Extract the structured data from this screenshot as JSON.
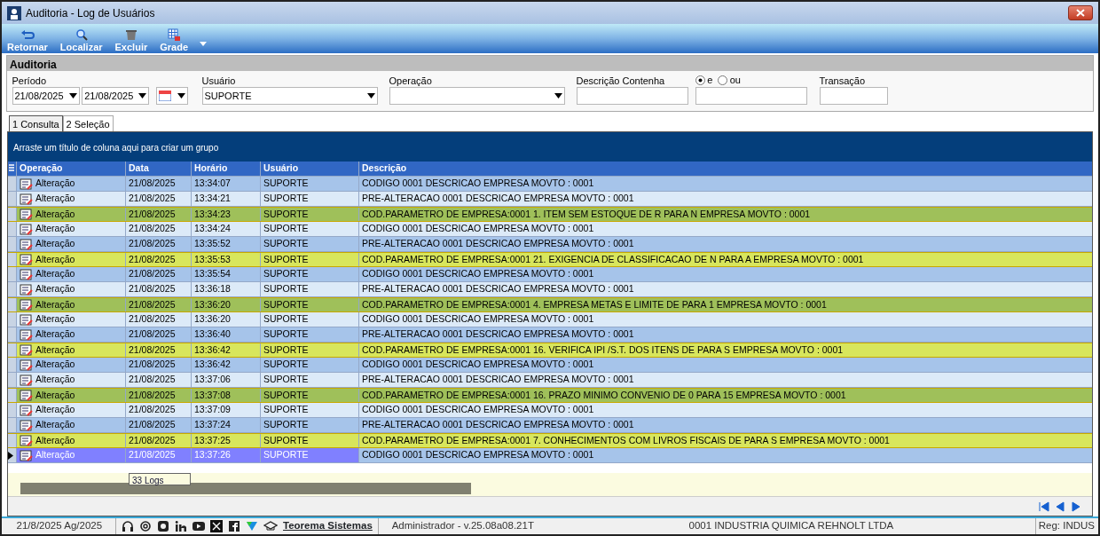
{
  "window": {
    "title": "Auditoria - Log de Usuários"
  },
  "toolbar": [
    {
      "label": "Retornar",
      "kind": "back"
    },
    {
      "label": "Localizar",
      "kind": "search"
    },
    {
      "label": "Excluir",
      "kind": "delete"
    },
    {
      "label": "Grade",
      "kind": "grid"
    }
  ],
  "filter_panel": {
    "title": "Auditoria",
    "period_label": "Período",
    "date_from": "21/08/2025",
    "date_to": "21/08/2025",
    "user_label": "Usuário",
    "user": "SUPORTE",
    "operation_label": "Operação",
    "description_label": "Descrição Contenha",
    "logic_options": [
      {
        "label": "e",
        "selected": true
      },
      {
        "label": "ou",
        "selected": false
      }
    ],
    "transaction_label": "Transação"
  },
  "tabs": [
    {
      "label": "1 Consulta",
      "selected": true
    },
    {
      "label": "2 Seleção",
      "selected": false
    }
  ],
  "group_hint": "Arraste um título de coluna aqui para criar um grupo",
  "table": {
    "columns": [
      "Operação",
      "Data",
      "Horário",
      "Usuário",
      "Descrição"
    ],
    "rows": [
      {
        "cells": [
          "Alteração",
          "21/08/2025",
          "13:34:07",
          "SUPORTE",
          "CODIGO 0001 DESCRICAO EMPRESA MOVTO : 0001"
        ],
        "color": "#a6c4ea",
        "selected": false
      },
      {
        "cells": [
          "Alteração",
          "21/08/2025",
          "13:34:21",
          "SUPORTE",
          "PRE-ALTERACAO 0001 DESCRICAO EMPRESA MOVTO : 0001"
        ],
        "color": "#dceaf8",
        "selected": false
      },
      {
        "cells": [
          "Alteração",
          "21/08/2025",
          "13:34:23",
          "SUPORTE",
          "COD.PARAMETRO DE EMPRESA:0001 1. ITEM SEM ESTOQUE DE R PARA N EMPRESA MOVTO : 0001"
        ],
        "color": "#9fc05a",
        "selected": false
      },
      {
        "cells": [
          "Alteração",
          "21/08/2025",
          "13:34:24",
          "SUPORTE",
          "CODIGO 0001 DESCRICAO EMPRESA MOVTO : 0001"
        ],
        "color": "#dceaf8",
        "selected": false
      },
      {
        "cells": [
          "Alteração",
          "21/08/2025",
          "13:35:52",
          "SUPORTE",
          "PRE-ALTERACAO 0001 DESCRICAO EMPRESA MOVTO : 0001"
        ],
        "color": "#a6c4ea",
        "selected": false
      },
      {
        "cells": [
          "Alteração",
          "21/08/2025",
          "13:35:53",
          "SUPORTE",
          "COD.PARAMETRO DE EMPRESA:0001 21. EXIGENCIA DE CLASSIFICACAO DE N PARA A EMPRESA MOVTO : 0001"
        ],
        "color": "#d8e65c",
        "selected": false
      },
      {
        "cells": [
          "Alteração",
          "21/08/2025",
          "13:35:54",
          "SUPORTE",
          "CODIGO 0001 DESCRICAO EMPRESA MOVTO : 0001"
        ],
        "color": "#a6c4ea",
        "selected": false
      },
      {
        "cells": [
          "Alteração",
          "21/08/2025",
          "13:36:18",
          "SUPORTE",
          "PRE-ALTERACAO 0001 DESCRICAO EMPRESA MOVTO : 0001"
        ],
        "color": "#dceaf8",
        "selected": false
      },
      {
        "cells": [
          "Alteração",
          "21/08/2025",
          "13:36:20",
          "SUPORTE",
          "COD.PARAMETRO DE EMPRESA:0001 4. EMPRESA METAS E LIMITE DE PARA 1 EMPRESA MOVTO : 0001"
        ],
        "color": "#9fc05a",
        "selected": false
      },
      {
        "cells": [
          "Alteração",
          "21/08/2025",
          "13:36:20",
          "SUPORTE",
          "CODIGO 0001 DESCRICAO EMPRESA MOVTO : 0001"
        ],
        "color": "#dceaf8",
        "selected": false
      },
      {
        "cells": [
          "Alteração",
          "21/08/2025",
          "13:36:40",
          "SUPORTE",
          "PRE-ALTERACAO 0001 DESCRICAO EMPRESA MOVTO : 0001"
        ],
        "color": "#a6c4ea",
        "selected": false
      },
      {
        "cells": [
          "Alteração",
          "21/08/2025",
          "13:36:42",
          "SUPORTE",
          "COD.PARAMETRO DE EMPRESA:0001 16. VERIFICA IPI /S.T. DOS ITENS DE PARA S EMPRESA MOVTO : 0001"
        ],
        "color": "#d8e65c",
        "selected": false
      },
      {
        "cells": [
          "Alteração",
          "21/08/2025",
          "13:36:42",
          "SUPORTE",
          "CODIGO 0001 DESCRICAO EMPRESA MOVTO : 0001"
        ],
        "color": "#a6c4ea",
        "selected": false
      },
      {
        "cells": [
          "Alteração",
          "21/08/2025",
          "13:37:06",
          "SUPORTE",
          "PRE-ALTERACAO 0001 DESCRICAO EMPRESA MOVTO : 0001"
        ],
        "color": "#dceaf8",
        "selected": false
      },
      {
        "cells": [
          "Alteração",
          "21/08/2025",
          "13:37:08",
          "SUPORTE",
          "COD.PARAMETRO DE EMPRESA:0001 16. PRAZO MINIMO CONVENIO DE 0 PARA 15 EMPRESA MOVTO : 0001"
        ],
        "color": "#9fc05a",
        "selected": false
      },
      {
        "cells": [
          "Alteração",
          "21/08/2025",
          "13:37:09",
          "SUPORTE",
          "CODIGO 0001 DESCRICAO EMPRESA MOVTO : 0001"
        ],
        "color": "#dceaf8",
        "selected": false
      },
      {
        "cells": [
          "Alteração",
          "21/08/2025",
          "13:37:24",
          "SUPORTE",
          "PRE-ALTERACAO 0001 DESCRICAO EMPRESA MOVTO : 0001"
        ],
        "color": "#a6c4ea",
        "selected": false
      },
      {
        "cells": [
          "Alteração",
          "21/08/2025",
          "13:37:25",
          "SUPORTE",
          "COD.PARAMETRO DE EMPRESA:0001 7. CONHECIMENTOS COM LIVROS FISCAIS DE PARA S EMPRESA MOVTO : 0001"
        ],
        "color": "#d8e65c",
        "selected": false
      },
      {
        "cells": [
          "Alteração",
          "21/08/2025",
          "13:37:26",
          "SUPORTE",
          "CODIGO 0001 DESCRICAO EMPRESA MOVTO : 0001"
        ],
        "color": "#a6c4ea",
        "selected": true
      }
    ],
    "footer": "33 Logs"
  },
  "status_bar": {
    "date": "21/8/2025 Ag/2025",
    "link": "Teorema Sistemas",
    "user": "Administrador - v.25.08a08.21T",
    "company": "0001 INDUSTRIA QUIMICA REHNOLT LTDA",
    "reg": "Reg: INDUS"
  }
}
